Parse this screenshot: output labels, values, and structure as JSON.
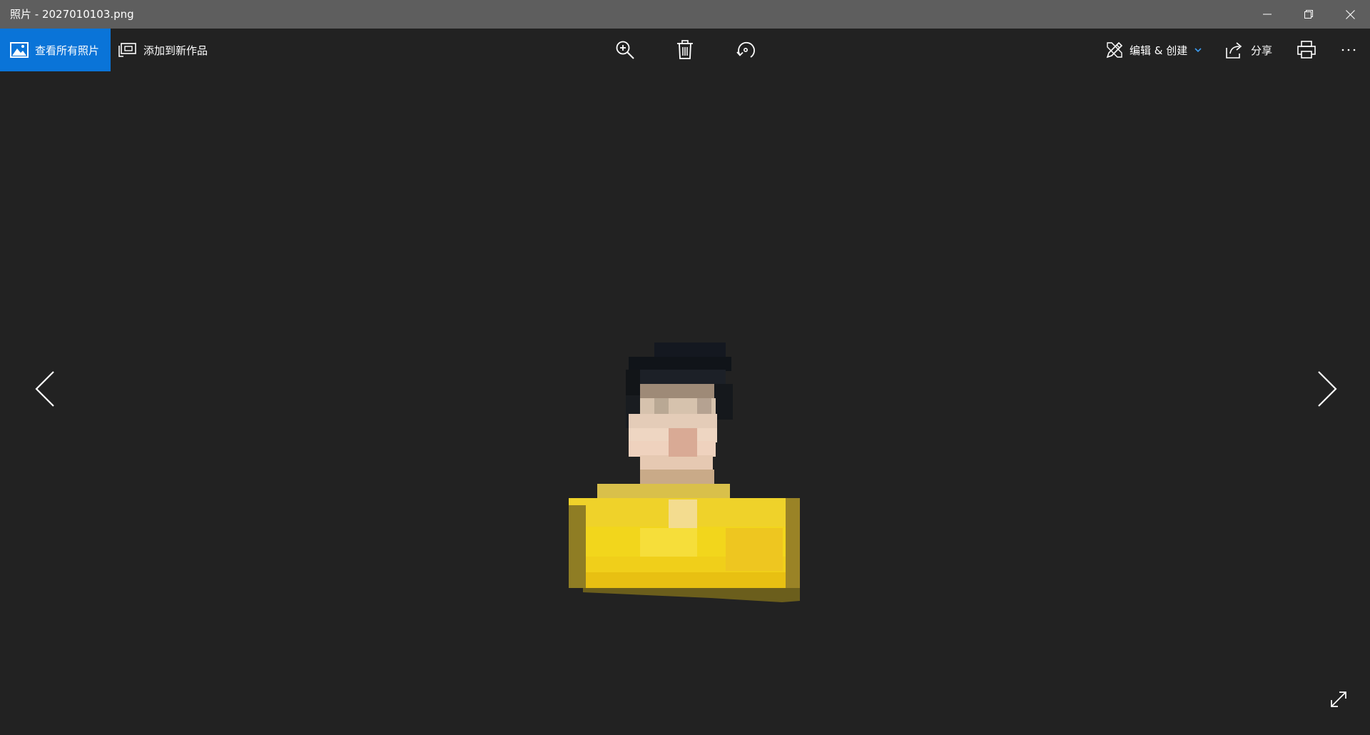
{
  "window": {
    "title": "照片 - 2027010103.png",
    "controls": {
      "minimize_icon": "minimize-icon",
      "restore_icon": "restore-icon",
      "close_icon": "close-icon"
    }
  },
  "toolbar": {
    "view_all_label": "查看所有照片",
    "add_to_creation_label": "添加到新作品",
    "edit_create_label": "编辑 & 创建",
    "share_label": "分享",
    "icons": [
      "zoom-in-icon",
      "delete-icon",
      "rotate-icon",
      "print-icon",
      "more-icon"
    ],
    "accent_color": "#0a74d8"
  },
  "viewer": {
    "background_color": "#222222",
    "prev_icon": "chevron-left-icon",
    "next_icon": "chevron-right-icon",
    "fullscreen_icon": "expand-icon"
  }
}
